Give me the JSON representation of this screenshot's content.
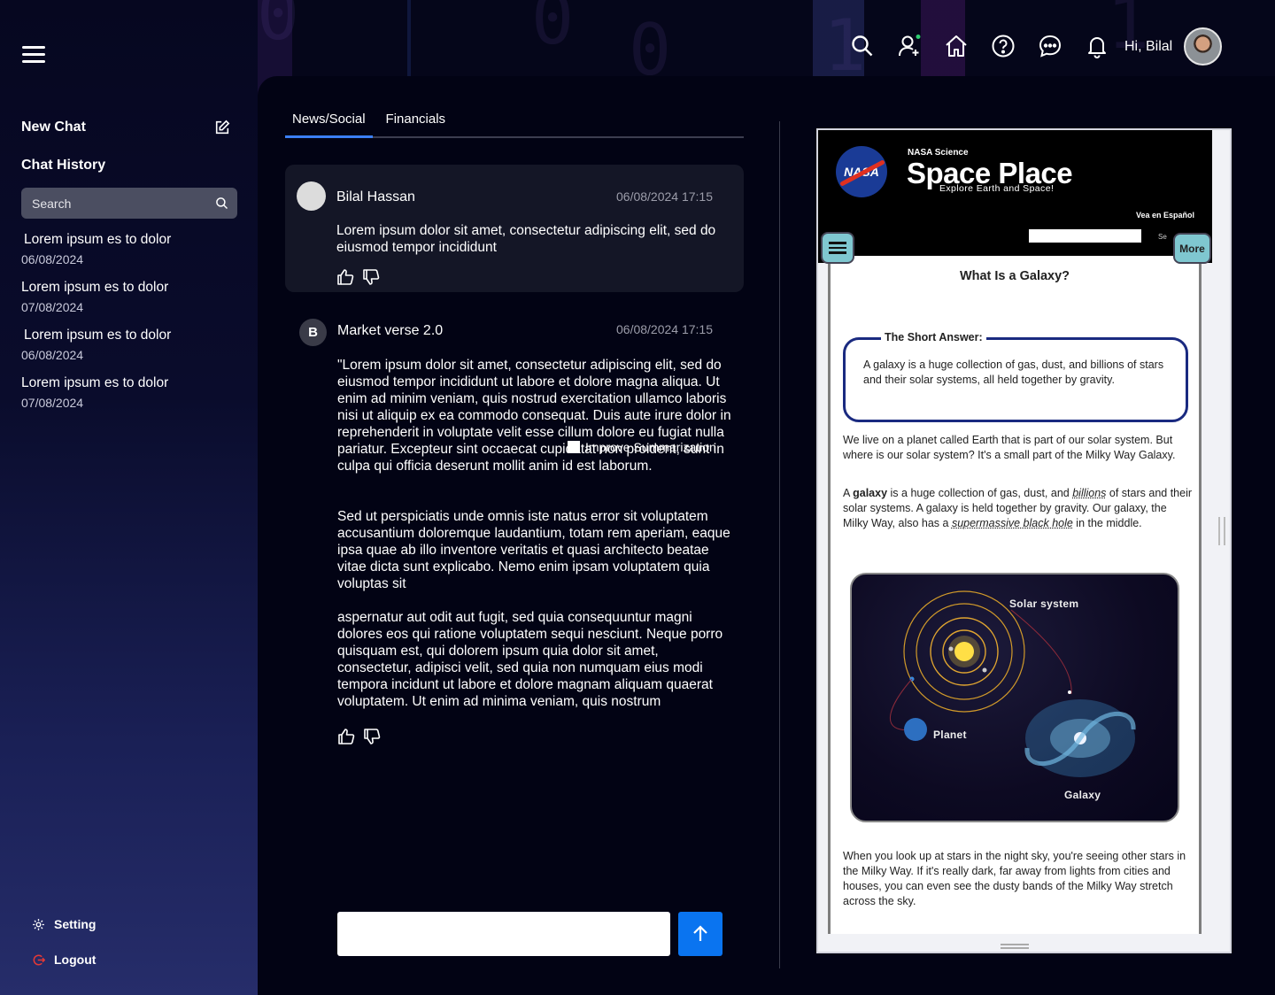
{
  "sidebar": {
    "new_chat": "New Chat",
    "chat_history": "Chat History",
    "search_placeholder": "Search",
    "history": [
      {
        "title": "Lorem ipsum es to dolor",
        "date": "06/08/2024"
      },
      {
        "title": "Lorem ipsum es to dolor",
        "date": "07/08/2024"
      },
      {
        "title": "Lorem ipsum es to dolor",
        "date": "06/08/2024"
      },
      {
        "title": "Lorem ipsum es to dolor",
        "date": "07/08/2024"
      }
    ],
    "setting": "Setting",
    "logout": "Logout"
  },
  "header": {
    "greeting": "Hi, Bilal",
    "icons": [
      "search-icon",
      "user-add-icon",
      "home-icon",
      "help-icon",
      "chat-icon",
      "bell-icon"
    ]
  },
  "tabs": [
    {
      "label": "News/Social",
      "active": true
    },
    {
      "label": "Financials",
      "active": false
    }
  ],
  "messages": {
    "user": {
      "name": "Bilal Hassan",
      "date": "06/08/2024 17:15",
      "text": "Lorem ipsum dolor sit amet, consectetur adipiscing elit, sed do eiusmod tempor incididunt"
    },
    "bot": {
      "name": "Market verse 2.0",
      "date": "06/08/2024 17:15",
      "avatar_letter": "B",
      "paragraphs": [
        "\"Lorem ipsum dolor sit amet, consectetur adipiscing elit, sed do eiusmod tempor incididunt ut labore et dolore magna aliqua. Ut enim ad minim veniam, quis nostrud exercitation ullamco laboris nisi ut aliquip ex ea commodo consequat. Duis aute irure dolor in reprehenderit in voluptate velit esse cillum dolore eu fugiat nulla pariatur. Excepteur sint occaecat cupidatat non proident, sunt in culpa qui officia deserunt mollit anim id est laborum.",
        "Sed ut perspiciatis unde omnis iste natus error sit voluptatem accusantium doloremque laudantium, totam rem aperiam, eaque ipsa quae ab illo inventore veritatis et quasi architecto beatae vitae dicta sunt explicabo. Nemo enim ipsam voluptatem quia voluptas sit",
        "aspernatur aut odit aut fugit, sed quia consequuntur magni dolores eos qui ratione voluptatem sequi nesciunt. Neque porro quisquam est, qui dolorem ipsum quia dolor sit amet, consectetur, adipisci velit, sed quia non numquam eius modi tempora incidunt ut labore et dolore magnam aliquam quaerat voluptatem. Ut enim ad minima veniam, quis nostrum"
      ],
      "tooltip": "Improve Summarization"
    }
  },
  "input": {
    "placeholder": ""
  },
  "preview": {
    "nasa": "NASA",
    "nasa_science": "NASA Science",
    "site_name": "Space Place",
    "tagline": "Explore Earth and Space!",
    "espanol": "Vea en Español",
    "search_cut": "Se",
    "more": "More",
    "page_title": "What Is a Galaxy?",
    "short_answer_label": "The Short Answer:",
    "short_answer": "A galaxy is a huge collection of gas, dust, and billions of stars and their solar systems, all held together by gravity.",
    "para1": "We live on a planet called Earth that is part of our solar system. But where is our solar system? It's a small part of the Milky Way Galaxy.",
    "para2_a": "A ",
    "para2_bold": "galaxy",
    "para2_b": " is a huge collection of gas, dust, and ",
    "para2_link1": "billions",
    "para2_c": " of stars and their solar systems. A galaxy is held together by gravity. Our galaxy, the Milky Way, also has a ",
    "para2_link2": "supermassive black hole",
    "para2_d": " in the middle.",
    "diagram_labels": {
      "solar": "Solar system",
      "planet": "Planet",
      "galaxy": "Galaxy"
    },
    "para3": "When you look up at stars in the night sky, you're seeing other stars in the Milky Way. If it's really dark, far away from lights from cities and houses, you can even see the dusty bands of the Milky Way stretch across the sky."
  },
  "colors": {
    "accent": "#0a74f0",
    "tab_active": "#3b7ff5",
    "card": "#141626"
  }
}
